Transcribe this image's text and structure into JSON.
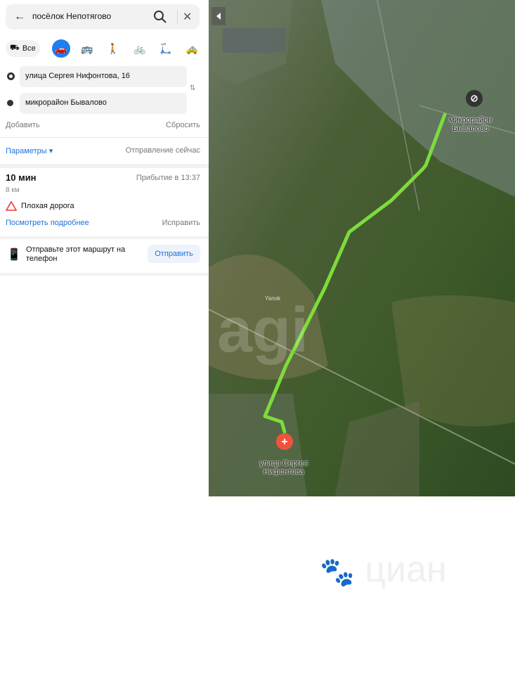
{
  "search": {
    "query": "посёлок Непотягово"
  },
  "modes": {
    "all_label": "Все",
    "icons": [
      "car-icon",
      "bus-icon",
      "walk-icon",
      "bike-icon",
      "scooter-icon",
      "taxi-icon"
    ],
    "active": "car-icon"
  },
  "route": {
    "from": "улица Сергея Нифонтова, 16",
    "to": "микрорайон Бывалово",
    "add": "Добавить",
    "reset": "Сбросить"
  },
  "params": {
    "label": "Параметры ▾",
    "departure": "Отправление сейчас"
  },
  "result": {
    "time": "10 мин",
    "arrival": "Прибытие в 13:37",
    "distance": "8 км",
    "warning": "Плохая дорога",
    "details": "Посмотреть подробнее",
    "fix": "Исправить"
  },
  "send": {
    "text": "Отправьте этот маршрут на телефон",
    "button": "Отправить"
  },
  "map": {
    "dest_label_1": "микрорайон",
    "dest_label_2": "Бывалово",
    "start_label_1": "улица Сергея",
    "start_label_2": "Нифонтова",
    "place": "Yanok",
    "route_color": "#7ddc3c"
  },
  "watermark": "циан"
}
